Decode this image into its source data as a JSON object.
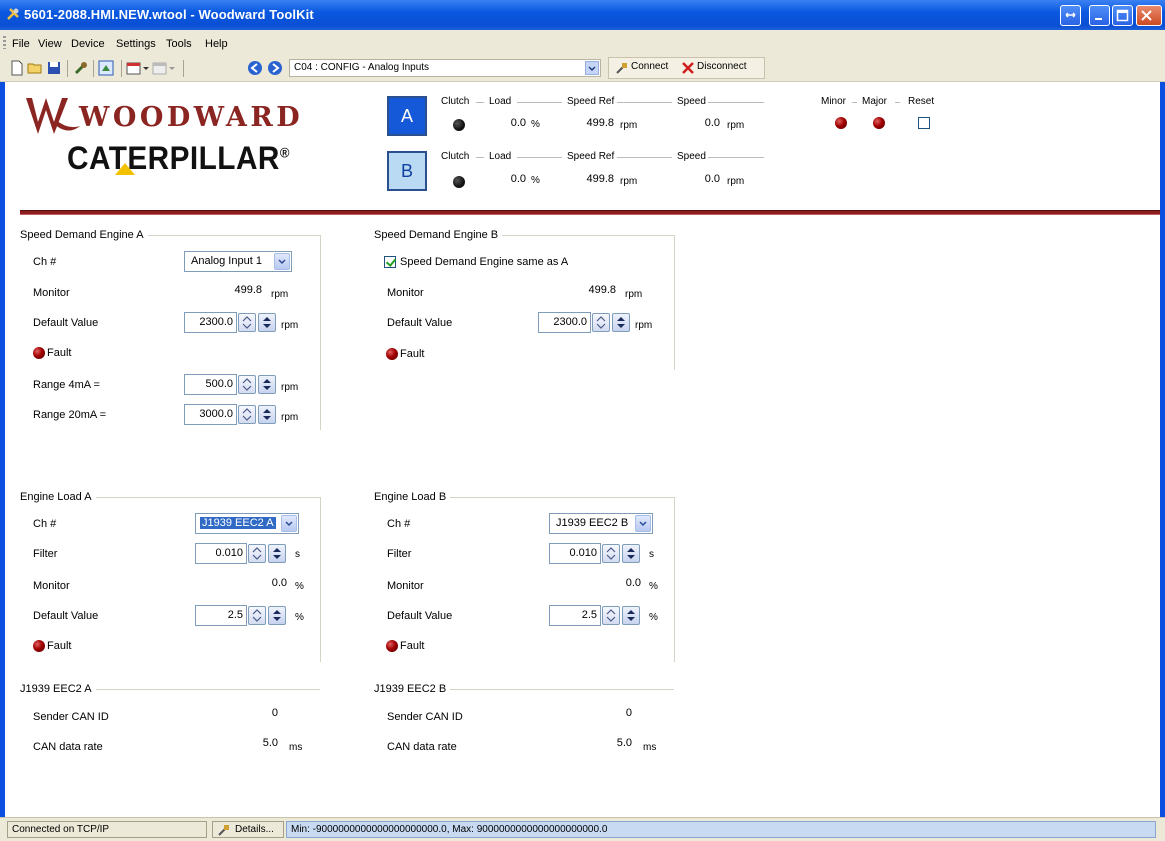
{
  "window": {
    "title": "5601-2088.HMI.NEW.wtool - Woodward ToolKit"
  },
  "menu": [
    "File",
    "View",
    "Device",
    "Settings",
    "Tools",
    "Help"
  ],
  "toolbar": {
    "page_select": "C04 : CONFIG - Analog Inputs",
    "connect_label": "Connect",
    "disconnect_label": "Disconnect"
  },
  "logos": {
    "woodward": "WOODWARD",
    "caterpillar": "CATERPILLAR",
    "caterpillar_mark": "®"
  },
  "header": {
    "labels": {
      "clutch": "Clutch",
      "load": "Load",
      "speed_ref": "Speed Ref",
      "speed": "Speed",
      "minor": "Minor",
      "major": "Major",
      "reset": "Reset"
    },
    "engine_a": {
      "button": "A",
      "load": "0.0",
      "load_unit": "%",
      "speed_ref": "499.8",
      "speed_ref_unit": "rpm",
      "speed": "0.0",
      "speed_unit": "rpm"
    },
    "engine_b": {
      "button": "B",
      "load": "0.0",
      "load_unit": "%",
      "speed_ref": "499.8",
      "speed_ref_unit": "rpm",
      "speed": "0.0",
      "speed_unit": "rpm"
    }
  },
  "speed_demand_a": {
    "title": "Speed Demand Engine A",
    "ch_label": "Ch #",
    "ch_value": "Analog Input 1",
    "monitor_label": "Monitor",
    "monitor_value": "499.8",
    "monitor_unit": "rpm",
    "default_label": "Default Value",
    "default_value": "2300.0",
    "default_unit": "rpm",
    "fault_label": "Fault",
    "range4_label": "Range 4mA =",
    "range4_value": "500.0",
    "range4_unit": "rpm",
    "range20_label": "Range 20mA =",
    "range20_value": "3000.0",
    "range20_unit": "rpm"
  },
  "speed_demand_b": {
    "title": "Speed Demand Engine B",
    "same_as_a_label": "Speed Demand Engine same as A",
    "same_as_a_checked": true,
    "monitor_label": "Monitor",
    "monitor_value": "499.8",
    "monitor_unit": "rpm",
    "default_label": "Default Value",
    "default_value": "2300.0",
    "default_unit": "rpm",
    "fault_label": "Fault"
  },
  "engine_load_a": {
    "title": "Engine Load A",
    "ch_label": "Ch #",
    "ch_value": "J1939 EEC2 A",
    "filter_label": "Filter",
    "filter_value": "0.010",
    "filter_unit": "s",
    "monitor_label": "Monitor",
    "monitor_value": "0.0",
    "monitor_unit": "%",
    "default_label": "Default Value",
    "default_value": "2.5",
    "default_unit": "%",
    "fault_label": "Fault"
  },
  "engine_load_b": {
    "title": "Engine Load B",
    "ch_label": "Ch #",
    "ch_value": "J1939 EEC2 B",
    "filter_label": "Filter",
    "filter_value": "0.010",
    "filter_unit": "s",
    "monitor_label": "Monitor",
    "monitor_value": "0.0",
    "monitor_unit": "%",
    "default_label": "Default Value",
    "default_value": "2.5",
    "default_unit": "%",
    "fault_label": "Fault"
  },
  "eec2_a": {
    "title": "J1939 EEC2 A",
    "sender_label": "Sender CAN ID",
    "sender_value": "0",
    "rate_label": "CAN data rate",
    "rate_value": "5.0",
    "rate_unit": "ms"
  },
  "eec2_b": {
    "title": "J1939 EEC2 B",
    "sender_label": "Sender CAN ID",
    "sender_value": "0",
    "rate_label": "CAN data rate",
    "rate_value": "5.0",
    "rate_unit": "ms"
  },
  "status": {
    "connection": "Connected on TCP/IP",
    "details_label": "Details...",
    "range_text": "Min: -9000000000000000000000.0, Max: 9000000000000000000000.0"
  },
  "colors": {
    "title_bar": "#0a58e0",
    "engine_a_button": "#1558d8",
    "engine_b_button": "#bad9f3",
    "divider": "#8b1f1f",
    "fault_led": "#a00000",
    "clutch_led": "#111111"
  }
}
